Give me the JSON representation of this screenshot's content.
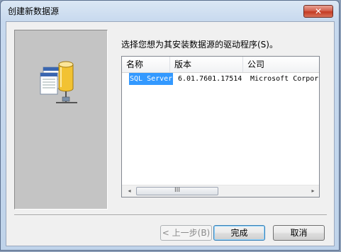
{
  "window": {
    "title": "创建新数据源"
  },
  "icons": {
    "close": "close-icon",
    "datasource": "database-datasource-icon"
  },
  "instruction": "选择您想为其安装数据源的驱动程序(S)。",
  "list": {
    "columns": [
      "名称",
      "版本",
      "公司"
    ],
    "rows": [
      {
        "name": "SQL Server",
        "version": "6.01.7601.17514",
        "company": "Microsoft Corpora"
      }
    ],
    "selected_index": 0
  },
  "scrollbar": {
    "thumb_glyph": "III",
    "left_arrow": "◂",
    "right_arrow": "▸"
  },
  "buttons": {
    "back": "< 上一步(B)",
    "finish": "完成",
    "cancel": "取消"
  },
  "colors": {
    "selection": "#3399ff",
    "close_button": "#c43a22"
  }
}
